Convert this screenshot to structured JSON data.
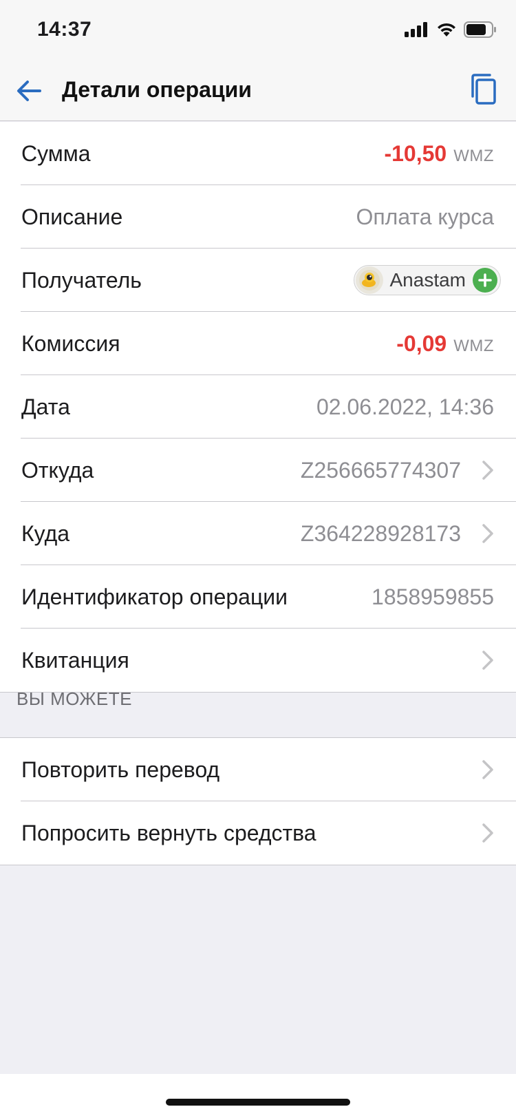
{
  "status_bar": {
    "time": "14:37"
  },
  "navbar": {
    "title": "Детали операции"
  },
  "details": {
    "amount": {
      "label": "Сумма",
      "value": "-10,50",
      "currency": "WMZ"
    },
    "description": {
      "label": "Описание",
      "value": "Оплата курса"
    },
    "recipient": {
      "label": "Получатель",
      "name": "Anastam"
    },
    "fee": {
      "label": "Комиссия",
      "value": "-0,09",
      "currency": "WMZ"
    },
    "date": {
      "label": "Дата",
      "value": "02.06.2022, 14:36"
    },
    "from": {
      "label": "Откуда",
      "value": "Z256665774307"
    },
    "to": {
      "label": "Куда",
      "value": "Z364228928173"
    },
    "operation_id": {
      "label": "Идентификатор операции",
      "value": "1858959855"
    },
    "receipt": {
      "label": "Квитанция"
    }
  },
  "actions": {
    "header": "ВЫ МОЖЕТЕ",
    "repeat": "Повторить перевод",
    "refund": "Попросить вернуть средства"
  },
  "colors": {
    "accent": "#2a6cc0",
    "negative": "#e53935",
    "secondary_text": "#8e8e93",
    "add_green": "#4caf50"
  },
  "icons": {
    "back": "arrow-left-icon",
    "copy": "copy-icon",
    "chevron": "chevron-right-icon",
    "add": "plus-circle-icon",
    "avatar": "webmoney-avatar-icon"
  }
}
